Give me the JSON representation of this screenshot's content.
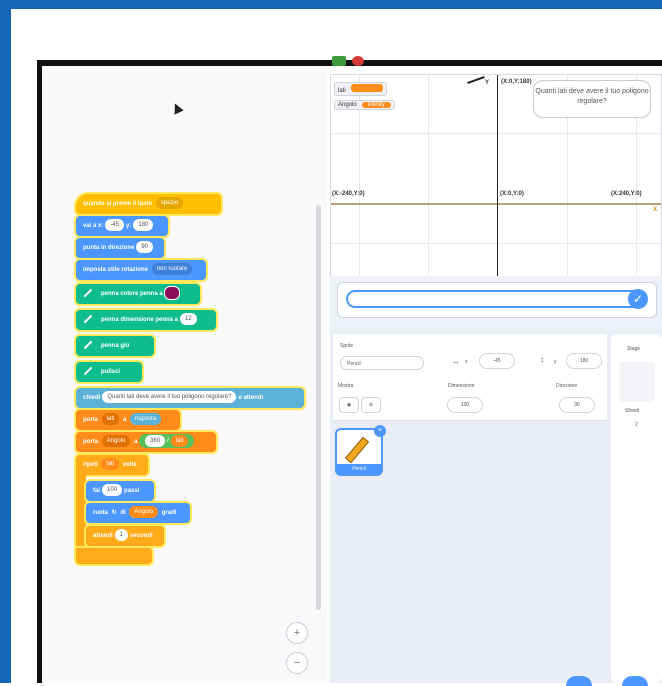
{
  "blocks": {
    "when_flag": "quando si preme il tasto",
    "when_flag_key": "spazio",
    "goto_label": "vai a x:",
    "goto_x": "-45",
    "goto_y_label": "y:",
    "goto_y": "180",
    "point_label": "punta in direzione",
    "point_value": "90",
    "rotation_label": "imposta stile rotazione",
    "rotation_value": "non ruotare",
    "pen_color_label": "penna colore penna a",
    "pen_size_label": "penna dimensione penna a",
    "pen_size_value": "12",
    "pen_down_label": "penna giù",
    "pen_erase_label": "pulisci",
    "ask_label": "chiedi",
    "ask_question": "Quanti lati deve avere il tuo poligono regolare?",
    "ask_wait": "e attendi",
    "set_lati_label": "porta",
    "set_lati_var": "lati",
    "set_lati_to": "a",
    "set_lati_value": "risposta",
    "set_angolo_label": "porta",
    "set_angolo_var": "Angolo",
    "set_angolo_to": "a",
    "set_angolo_value": "360",
    "set_angolo_div": "/",
    "set_angolo_div_var": "lati",
    "repeat_label": "ripeti",
    "repeat_var": "lati",
    "repeat_suffix": "volte",
    "move_label": "fai",
    "move_value": "100",
    "move_suffix": "passi",
    "turn_label": "ruota",
    "turn_of": "di",
    "turn_var": "Angolo",
    "turn_suffix": "gradi",
    "wait_label": "attendi",
    "wait_value": "1",
    "wait_suffix": "secondi"
  },
  "stage": {
    "var_lati_label": "lati",
    "var_lati_value": "",
    "var_angolo_label": "Angolo",
    "var_angolo_value": "infinity",
    "speech": "Quanti lati deve avere il tuo poligono regolare?",
    "coord_top": "(X:0,Y:180)",
    "coord_left": "(X:-240,Y:0)",
    "coord_center": "(X:0,Y:0)",
    "coord_right": "(X:240,Y:0)",
    "y_axis": "Y",
    "x_axis": "X"
  },
  "ask": {
    "value": ""
  },
  "sprite_info": {
    "sprite_label": "Sprite",
    "sprite_name": "Pencil",
    "x_value": "-45",
    "y_value": "180",
    "show_label": "Mostra",
    "size_label": "Dimensione",
    "size_value": "100",
    "direction_label": "Direzione",
    "direction_value": "90"
  },
  "sprite_list": [
    {
      "name": "Pencil"
    }
  ],
  "stage_panel": {
    "title": "Stage",
    "backdrops_label": "Sfondi",
    "backdrops_count": "2"
  },
  "colors": {
    "motion": "#4c97ff",
    "pen": "#0fbd8c",
    "events": "#ffbf00",
    "variables": "#ff8c1a",
    "sensing": "#5cb1d6",
    "frame": "#1466b8",
    "pen_color_swatch": "#8e0b5a"
  }
}
